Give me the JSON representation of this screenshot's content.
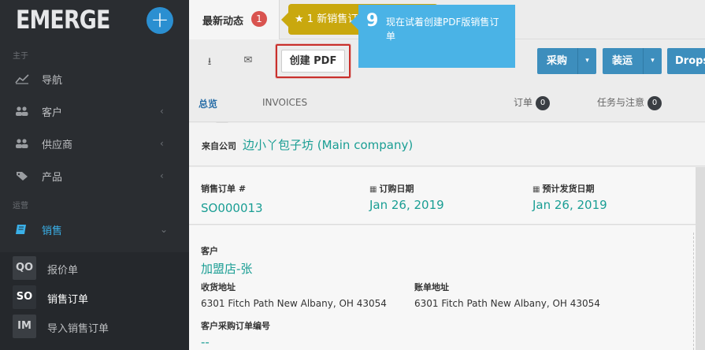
{
  "app": {
    "logo": "EMERGE",
    "plus": "+"
  },
  "sidebar": {
    "section_main": "主于",
    "section_ops": "运营",
    "items": [
      {
        "label": "导航",
        "icon": "chart-icon",
        "chevron": ""
      },
      {
        "label": "客户",
        "icon": "users-icon",
        "chevron": "‹"
      },
      {
        "label": "供应商",
        "icon": "users-icon",
        "chevron": "‹"
      },
      {
        "label": "产品",
        "icon": "tag-icon",
        "chevron": "‹"
      },
      {
        "label": "销售",
        "icon": "book-icon",
        "chevron": "⌄"
      }
    ],
    "subitems": [
      {
        "badge": "QO",
        "label": "报价单"
      },
      {
        "badge": "SO",
        "label": "销售订单"
      },
      {
        "badge": "IM",
        "label": "导入销售订单"
      }
    ]
  },
  "topbar": {
    "activity_label": "最新动态",
    "activity_count": "1",
    "notice": "★ 1 新销售订单 ✖"
  },
  "toolbar": {
    "download_icon": "⭳",
    "mail_icon": "✉",
    "pdf_label": "创建 PDF",
    "buttons": [
      {
        "label": "采购",
        "dropdown": "▾"
      },
      {
        "label": "装运",
        "dropdown": "▾"
      },
      {
        "label": "Drops",
        "dropdown": ""
      }
    ]
  },
  "tooltip": {
    "step": "9",
    "text": "现在试着创建PDF版销售订单"
  },
  "tabs": [
    {
      "label": "总览",
      "count": ""
    },
    {
      "label": "INVOICES",
      "count": ""
    },
    {
      "label": "订单",
      "count": "0"
    },
    {
      "label": "任务与注意",
      "count": "0"
    }
  ],
  "company": {
    "label": "来自公司",
    "name": "边小丫包子坊 (Main company)"
  },
  "order": {
    "number_label": "销售订单 #",
    "number": "SO000013",
    "order_date_label": "订购日期",
    "order_date": "Jan 26, 2019",
    "ship_date_label": "预计发货日期",
    "ship_date": "Jan 26, 2019"
  },
  "customer": {
    "label": "客户",
    "name": "加盟店-张",
    "shipping_label": "收货地址",
    "shipping_address": "6301 Fitch Path New Albany, OH 43054",
    "billing_label": "账单地址",
    "billing_address": "6301 Fitch Path New Albany, OH 43054",
    "po_label": "客户采购订单编号",
    "po_value": "--"
  },
  "colors": {
    "accent_teal": "#1a9e94",
    "accent_blue": "#3d8ebd",
    "highlight_red": "#c9302c",
    "tooltip_blue": "#4ab3e6",
    "notice_yellow": "#c9a80e"
  }
}
